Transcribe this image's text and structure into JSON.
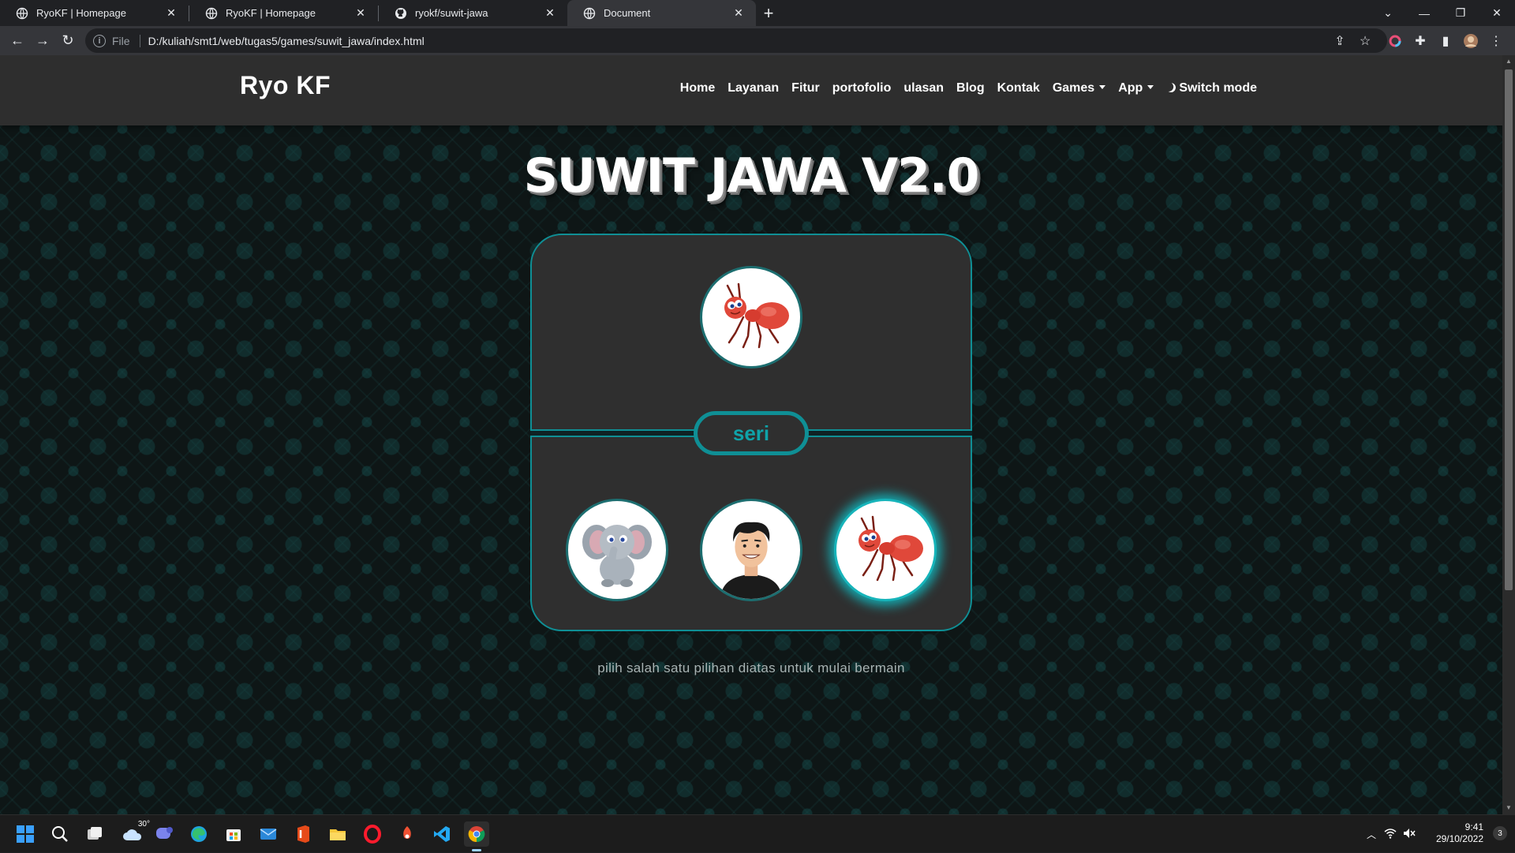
{
  "browser": {
    "tabs": [
      {
        "title": "RyoKF | Homepage",
        "icon": "globe-icon",
        "active": false
      },
      {
        "title": "RyoKF | Homepage",
        "icon": "globe-icon",
        "active": false
      },
      {
        "title": "ryokf/suwit-jawa",
        "icon": "github-icon",
        "active": false
      },
      {
        "title": "Document",
        "icon": "globe-icon",
        "active": true
      }
    ],
    "new_tab_label": "+",
    "address": {
      "scheme": "File",
      "url": "D:/kuliah/smt1/web/tugas5/games/suwit_jawa/index.html"
    }
  },
  "site": {
    "brand": "Ryo KF",
    "menu": [
      {
        "label": "Home"
      },
      {
        "label": "Layanan"
      },
      {
        "label": "Fitur"
      },
      {
        "label": "portofolio"
      },
      {
        "label": "ulasan"
      },
      {
        "label": "Blog"
      },
      {
        "label": "Kontak"
      },
      {
        "label": "Games",
        "dropdown": true
      },
      {
        "label": "App",
        "dropdown": true
      }
    ],
    "switch_mode": "Switch mode"
  },
  "game": {
    "title": "SUWIT JAWA V2.0",
    "computer_choice": "semut",
    "result": "seri",
    "player_choices": [
      {
        "name": "gajah",
        "icon": "elephant-icon",
        "selected": false
      },
      {
        "name": "orang",
        "icon": "person-icon",
        "selected": false
      },
      {
        "name": "semut",
        "icon": "ant-icon",
        "selected": true
      }
    ],
    "hint": "pilih salah satu pilihan diatas untuk mulai bermain"
  },
  "colors": {
    "accent": "#0f8f95",
    "panel": "#2f2f2f",
    "navbar": "#2e2e2e",
    "background": "#0e1616"
  },
  "taskbar": {
    "weather": "30°",
    "time": "9:41",
    "date": "29/10/2022",
    "notifications": "3"
  }
}
